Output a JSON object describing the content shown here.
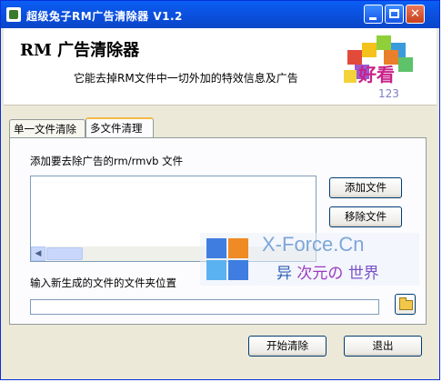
{
  "window": {
    "title": "超级兔子RM广告清除器 V1.2",
    "controls": {
      "minimize": "",
      "maximize": "",
      "close": "✕"
    }
  },
  "header": {
    "title": "RM 广告清除器",
    "subtitle": "它能去掉RM文件中一切外加的特效信息及广告",
    "logo_text": "好看",
    "logo_number": "123"
  },
  "tabs": [
    {
      "label": "单一文件清除",
      "active": false
    },
    {
      "label": "多文件清理",
      "active": true
    }
  ],
  "panel": {
    "add_label": "添加要去除广告的rm/rmvb 文件",
    "add_button": "添加文件",
    "remove_button": "移除文件",
    "output_label": "输入新生成的文件的文件夹位置",
    "output_value": ""
  },
  "footer": {
    "start_button": "开始清除",
    "exit_button": "退出"
  },
  "watermark": {
    "line1": "X-Force.Cn",
    "line2_a": "异",
    "line2_b": "次元の",
    "line2_c": "世界"
  },
  "colors": {
    "titlebar": "#0b4fdc",
    "tab_highlight": "#f5b947",
    "button_border": "#003c74"
  }
}
